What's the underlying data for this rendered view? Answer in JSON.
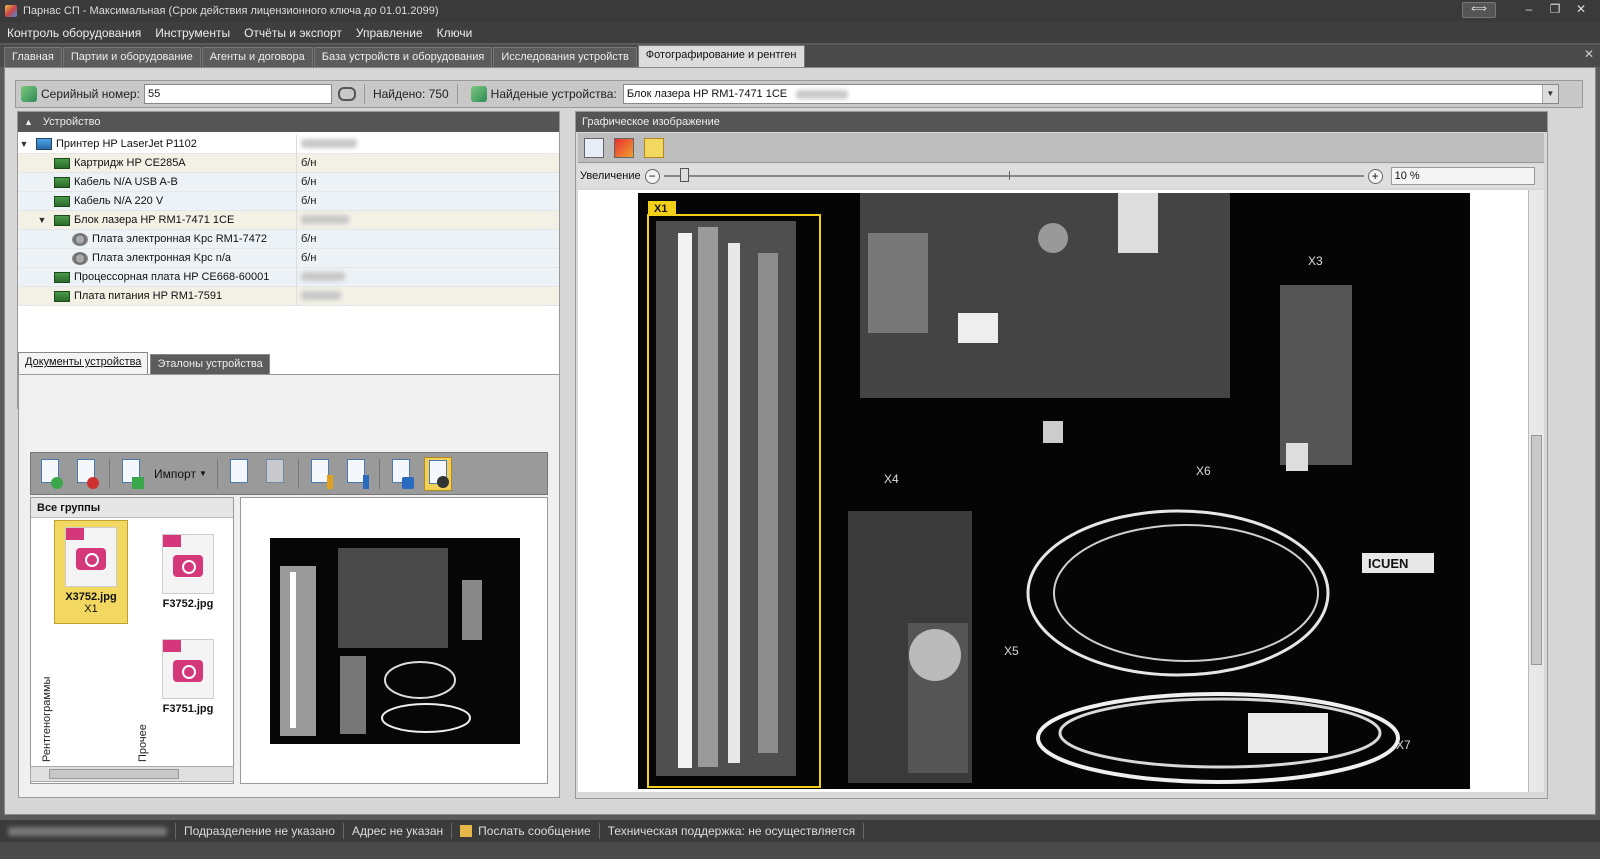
{
  "window": {
    "title": "Парнас СП - Максимальная (Срок действия лицензионного ключа до 01.01.2099)"
  },
  "menu": [
    "Контроль оборудования",
    "Инструменты",
    "Отчёты и экспорт",
    "Управление",
    "Ключи"
  ],
  "tabs": [
    "Главная",
    "Партии и оборудование",
    "Агенты и договора",
    "База устройств и оборудования",
    "Исследования устройств",
    "Фотографирование и рентген"
  ],
  "search": {
    "serial_label": "Серийный номер:",
    "serial_value": "55",
    "found_label": "Найдено: 750",
    "devices_label": "Найденые устройства:",
    "devices_value": "Блок лазера HP RM1-7471 1CE"
  },
  "device_panel": {
    "header": "Устройство",
    "rows": [
      {
        "name": "Принтер  HP LaserJet P1102",
        "value": ""
      },
      {
        "name": "Картридж  HP CE285A",
        "value": "б/н"
      },
      {
        "name": "Кабель  N/A USB A-B",
        "value": "б/н"
      },
      {
        "name": "Кабель  N/A 220 V",
        "value": "б/н"
      },
      {
        "name": "Блок лазера  HP RM1-7471 1CE",
        "value": ""
      },
      {
        "name": "Плата электронная  Kpc RM1-7472",
        "value": "б/н"
      },
      {
        "name": "Плата электронная  Kpc n/a",
        "value": "б/н"
      },
      {
        "name": "Процессорная плата  HP CE668-60001",
        "value": ""
      },
      {
        "name": "Плата питания  HP RM1-7591",
        "value": ""
      }
    ]
  },
  "doc_tabs": [
    "Документы устройства",
    "Эталоны устройства"
  ],
  "doc_toolbar": {
    "import_label": "Импорт"
  },
  "groups": {
    "header": "Все группы",
    "xray_group": "Рентгенограммы",
    "other_group": "Прочее",
    "files": [
      {
        "name": "X3752.jpg",
        "sub": "X1"
      },
      {
        "name": "F3752.jpg",
        "sub": ""
      },
      {
        "name": "F3751.jpg",
        "sub": ""
      }
    ]
  },
  "image_panel": {
    "header": "Графическое изображение",
    "zoom_label": "Увеличение",
    "zoom_value": "10 %",
    "zoom_fraction": 0.02,
    "markers": [
      "X1",
      "X3",
      "X4",
      "X6",
      "X5",
      "X7",
      "ICUEN"
    ]
  },
  "status": {
    "division": "Подразделение не указано",
    "address": "Адрес не указан",
    "send_message": "Послать сообщение",
    "support": "Техническая поддержка: не осуществляется"
  },
  "colors": {
    "accent_yellow": "#f2d860",
    "frame_dark": "#3a3a3a"
  }
}
